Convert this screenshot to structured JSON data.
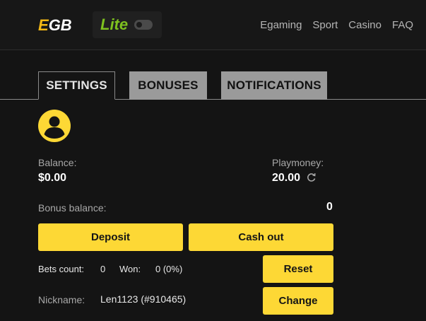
{
  "header": {
    "logo_e": "E",
    "logo_gb": "GB",
    "lite_label": "Lite",
    "nav": [
      "Egaming",
      "Sport",
      "Casino",
      "FAQ"
    ]
  },
  "tabs": [
    {
      "label": "SETTINGS",
      "active": true
    },
    {
      "label": "BONUSES",
      "active": false
    },
    {
      "label": "NOTIFICATIONS",
      "active": false
    }
  ],
  "account": {
    "balance_label": "Balance:",
    "balance_value": "$0.00",
    "playmoney_label": "Playmoney:",
    "playmoney_value": "20.00",
    "bonus_label": "Bonus balance:",
    "bonus_value": "0"
  },
  "actions": {
    "deposit": "Deposit",
    "cashout": "Cash out",
    "reset": "Reset",
    "change": "Change"
  },
  "stats": {
    "bets_label": "Bets count:",
    "bets_value": "0",
    "won_label": "Won:",
    "won_value": "0 (0%)"
  },
  "profile": {
    "nickname_label": "Nickname:",
    "nickname_value": "Len1123 (#910465)"
  },
  "colors": {
    "accent_yellow": "#fdd835",
    "logo_orange": "#f5b914",
    "lite_green": "#7ec11f",
    "background": "#141414"
  }
}
